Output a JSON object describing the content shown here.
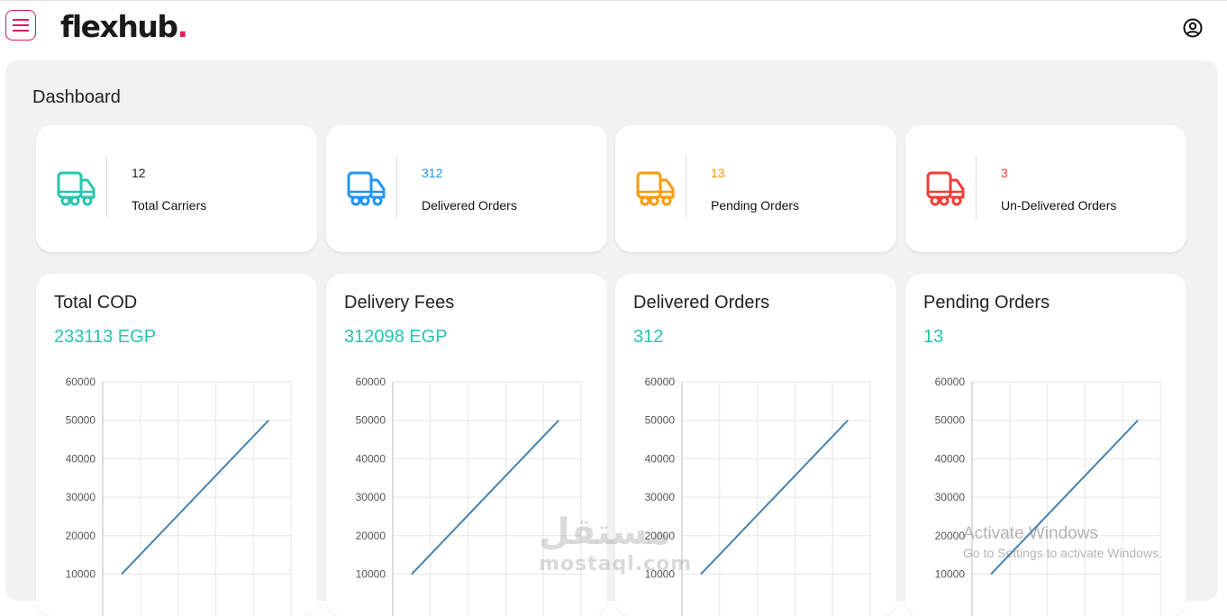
{
  "app": {
    "logo_text": "flexhub",
    "logo_dot": ".",
    "brand_color": "#e91e63"
  },
  "page": {
    "title": "Dashboard"
  },
  "icons": {
    "menu": "hamburger-menu-icon",
    "profile": "user-circle-icon",
    "truck": "truck-icon"
  },
  "stats": [
    {
      "value": "12",
      "label": "Total Carriers",
      "color": "#26c6ae",
      "value_color": "#222222"
    },
    {
      "value": "312",
      "label": "Delivered Orders",
      "color": "#2196f3",
      "value_color": "#2196f3"
    },
    {
      "value": "13",
      "label": "Pending Orders",
      "color": "#fb9b0b",
      "value_color": "#fb9b0b"
    },
    {
      "value": "3",
      "label": "Un-Delivered Orders",
      "color": "#ef3e36",
      "value_color": "#ef3e36"
    }
  ],
  "cards": [
    {
      "title": "Total COD",
      "value": "233113 EGP"
    },
    {
      "title": "Delivery Fees",
      "value": "312098 EGP"
    },
    {
      "title": "Delivered Orders",
      "value": "312"
    },
    {
      "title": "Pending Orders",
      "value": "13"
    }
  ],
  "chart_data": [
    {
      "type": "line",
      "title": "",
      "ylim": [
        10000,
        60000
      ],
      "yticks": [
        "60000",
        "50000",
        "40000",
        "30000",
        "20000",
        "10000"
      ],
      "grid": true,
      "series": [
        {
          "x": [
            0,
            4
          ],
          "values": [
            10000,
            50000
          ]
        }
      ],
      "line_color": "#4682b4"
    },
    {
      "type": "line",
      "title": "",
      "ylim": [
        10000,
        60000
      ],
      "yticks": [
        "60000",
        "50000",
        "40000",
        "30000",
        "20000",
        "10000"
      ],
      "grid": true,
      "series": [
        {
          "x": [
            0,
            4
          ],
          "values": [
            10000,
            50000
          ]
        }
      ],
      "line_color": "#4682b4"
    },
    {
      "type": "line",
      "title": "",
      "ylim": [
        10000,
        60000
      ],
      "yticks": [
        "60000",
        "50000",
        "40000",
        "30000",
        "20000",
        "10000"
      ],
      "grid": true,
      "series": [
        {
          "x": [
            0,
            4
          ],
          "values": [
            10000,
            50000
          ]
        }
      ],
      "line_color": "#4682b4"
    },
    {
      "type": "line",
      "title": "",
      "ylim": [
        10000,
        60000
      ],
      "yticks": [
        "60000",
        "50000",
        "40000",
        "30000",
        "20000",
        "10000"
      ],
      "grid": true,
      "series": [
        {
          "x": [
            0,
            4
          ],
          "values": [
            10000,
            50000
          ]
        }
      ],
      "line_color": "#4682b4"
    }
  ],
  "watermark": {
    "arabic": "مستقل",
    "latin": "mostaql.com"
  },
  "os_notice": {
    "line1": "Activate Windows",
    "line2": "Go to Settings to activate Windows."
  }
}
